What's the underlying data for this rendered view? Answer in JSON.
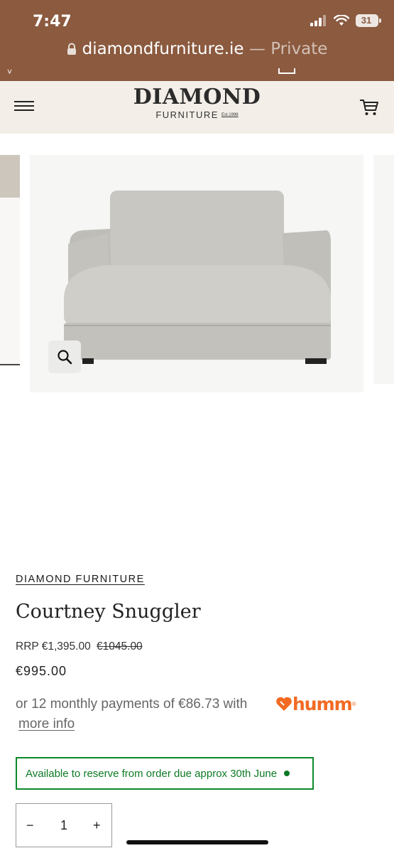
{
  "status_bar": {
    "time": "7:47",
    "battery": "31",
    "url_domain": "diamondfurniture.ie",
    "url_suffix": " — Private"
  },
  "header": {
    "logo_main": "DIAMOND",
    "logo_sub": "FURNITURE",
    "logo_est": "Est.1998"
  },
  "product": {
    "brand": "DIAMOND FURNITURE",
    "title": "Courtney Snuggler",
    "rrp_label": "RRP €1,395.00",
    "old_price": "€1045.00",
    "price": "€995.00",
    "instalment_text": "or 12 monthly payments of €86.73 with",
    "humm_logo": "humm",
    "more_info": "more info",
    "availability": "Available to reserve from order due approx 30th June",
    "quantity": "1",
    "minus": "−",
    "plus": "+"
  },
  "colors": {
    "status_bar_bg": "#8b5a3f",
    "header_bg": "#f3efe8",
    "availability_green": "#0c8a2c",
    "humm_orange": "#f26a22"
  }
}
